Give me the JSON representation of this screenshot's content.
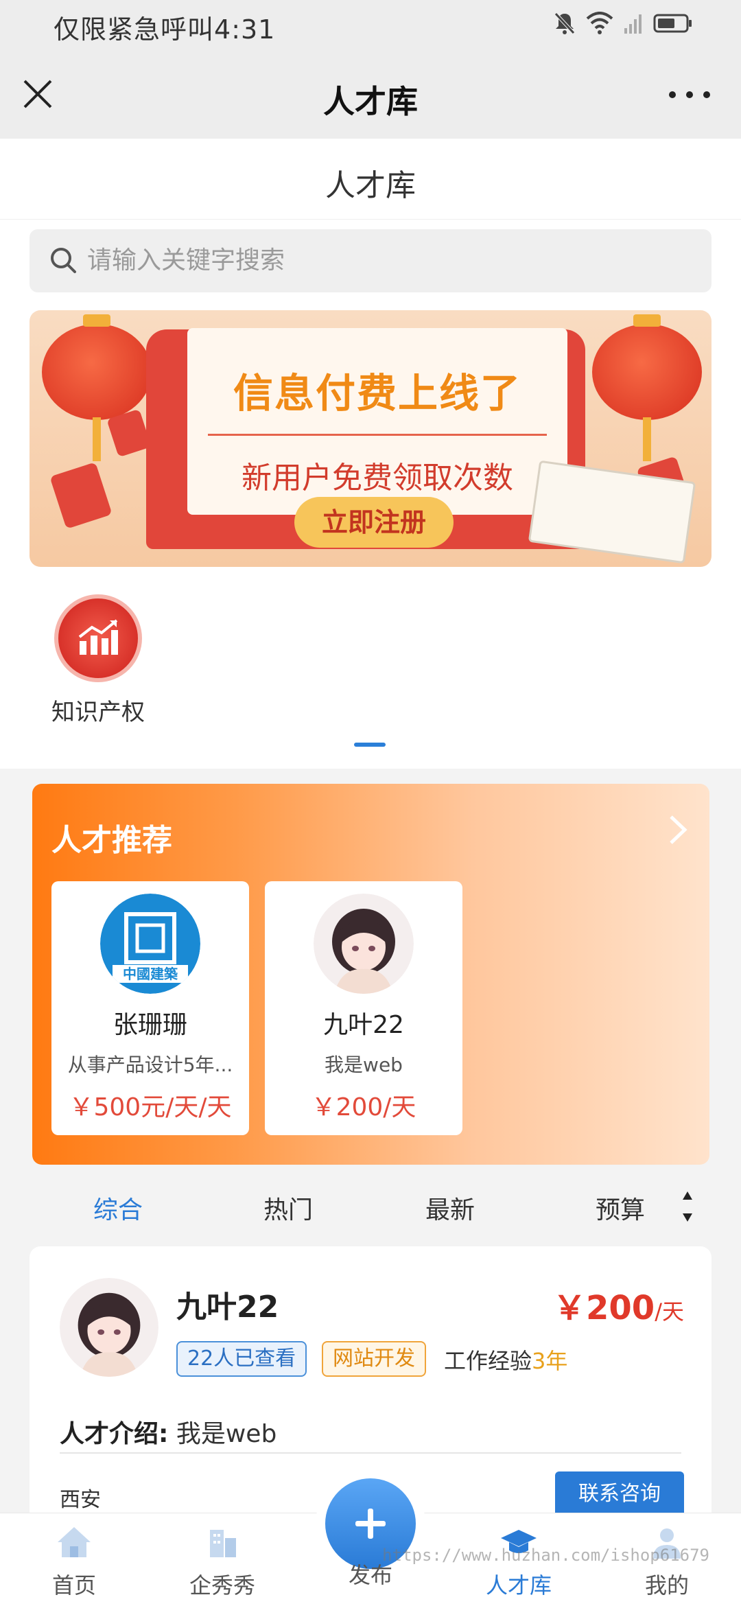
{
  "status_bar": {
    "carrier_text": "仅限紧急呼叫",
    "time": "4:31"
  },
  "nav": {
    "title": "人才库"
  },
  "page_title": "人才库",
  "search": {
    "placeholder": "请输入关键字搜索"
  },
  "banner": {
    "headline": "信息付费上线了",
    "subline": "新用户免费领取次数",
    "button": "立即注册"
  },
  "categories": [
    {
      "label": "知识产权",
      "icon": "chart-up-icon"
    }
  ],
  "recommend": {
    "title": "人才推荐",
    "cards": [
      {
        "name": "张珊珊",
        "desc": "从事产品设计5年...",
        "price": "￥500元/天/天",
        "avatar": "company-logo",
        "logo_text": "中國建築"
      },
      {
        "name": "九叶22",
        "desc": "我是web",
        "price": "￥200/天",
        "avatar": "anime-girl"
      }
    ]
  },
  "sort_tabs": [
    "综合",
    "热门",
    "最新",
    "预算"
  ],
  "sort_active": "综合",
  "talent": {
    "name": "九叶22",
    "price": "￥200",
    "unit": "/天",
    "views_badge": "22人已查看",
    "skill_badge": "网站开发",
    "exp_label": "工作经验",
    "exp_value": "3年",
    "intro_label": "人才介绍:",
    "intro_text": "我是web",
    "city": "西安",
    "contact_button": "联系咨询"
  },
  "tabs": [
    {
      "label": "首页",
      "icon": "home-icon"
    },
    {
      "label": "企秀秀",
      "icon": "building-icon"
    },
    {
      "label": "发布",
      "icon": "plus-icon"
    },
    {
      "label": "人才库",
      "icon": "graduation-cap-icon"
    },
    {
      "label": "我的",
      "icon": "user-icon"
    }
  ],
  "active_tab": "人才库",
  "watermark": "https://www.huzhan.com/ishop61679",
  "colors": {
    "accent": "#2a7bd6",
    "price": "#e0392a",
    "orange": "#ff7a12"
  }
}
